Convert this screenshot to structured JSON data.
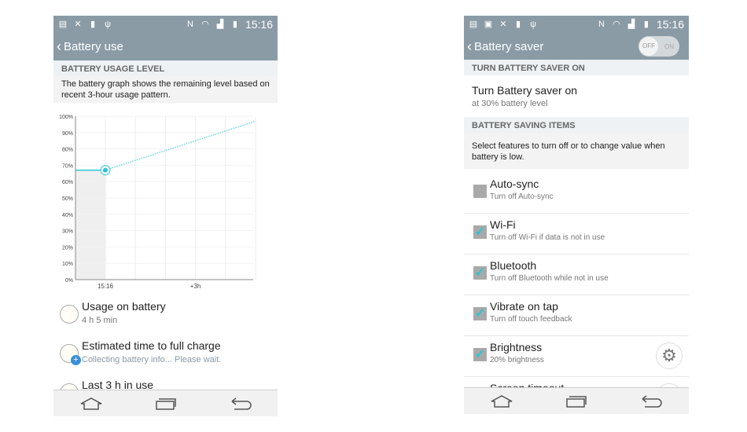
{
  "status": {
    "time": "15:16"
  },
  "battery_use": {
    "title": "Battery use",
    "section": "BATTERY USAGE LEVEL",
    "description": "The battery graph shows the remaining level based on recent 3-hour usage pattern.",
    "items": [
      {
        "title": "Usage on battery",
        "subtitle": "4 h 5 min",
        "icon": "clock-icon"
      },
      {
        "title": "Estimated time to full charge",
        "subtitle": "Collecting battery info... Please wait.",
        "icon": "clock-plus-icon"
      },
      {
        "title": "Last 3 h in use",
        "subtitle": "",
        "icon": "clock-icon"
      }
    ]
  },
  "chart_data": {
    "type": "line",
    "y_ticks": [
      "0%",
      "10%",
      "20%",
      "30%",
      "40%",
      "50%",
      "60%",
      "70%",
      "80%",
      "90%",
      "100%"
    ],
    "x_labels": [
      "15:16",
      "+3h"
    ],
    "ylim": [
      0,
      100
    ],
    "grid": true,
    "series": [
      {
        "style": "solid",
        "points": [
          [
            -1,
            67
          ],
          [
            0,
            67
          ]
        ]
      },
      {
        "style": "dotted-projection",
        "points": [
          [
            0,
            67
          ],
          [
            5,
            97
          ]
        ]
      }
    ],
    "accent": "#29c6d6"
  },
  "battery_saver": {
    "title": "Battery saver",
    "toggle": {
      "off": "OFF",
      "on": "ON",
      "state": "off"
    },
    "section1": "TURN BATTERY SAVER ON",
    "turn_on": {
      "title": "Turn Battery saver on",
      "subtitle": "at 30% battery level"
    },
    "section2": "BATTERY SAVING ITEMS",
    "description": "Select features to turn off or to change value when battery is low.",
    "items": [
      {
        "title": "Auto-sync",
        "subtitle": "Turn off Auto-sync",
        "checked": false,
        "gear": false
      },
      {
        "title": "Wi-Fi",
        "subtitle": "Turn off Wi-Fi if data is not in use",
        "checked": true,
        "gear": false
      },
      {
        "title": "Bluetooth",
        "subtitle": "Turn off Bluetooth while not in use",
        "checked": true,
        "gear": false
      },
      {
        "title": "Vibrate on tap",
        "subtitle": "Turn off touch feedback",
        "checked": true,
        "gear": false
      },
      {
        "title": "Brightness",
        "subtitle": "20% brightness",
        "checked": true,
        "gear": true
      },
      {
        "title": "Screen timeout",
        "subtitle": "",
        "checked": false,
        "gear": true
      }
    ]
  }
}
